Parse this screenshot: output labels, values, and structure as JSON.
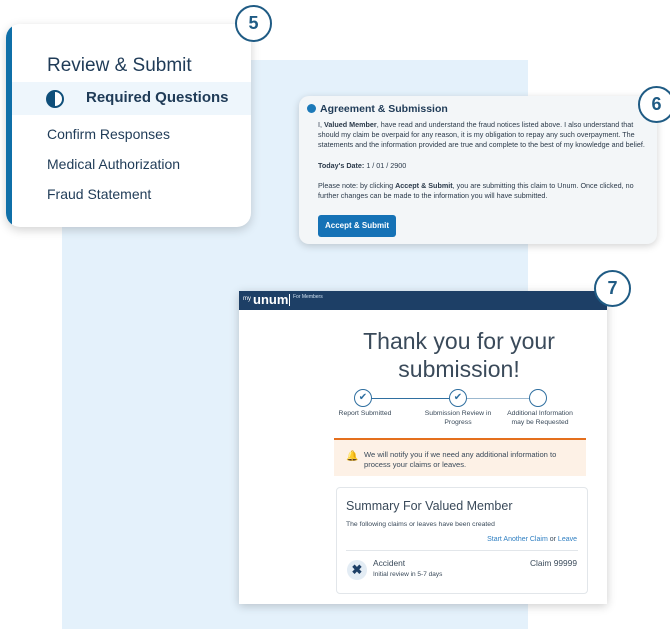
{
  "steps": {
    "five": "5",
    "six": "6",
    "seven": "7"
  },
  "review": {
    "title": "Review & Submit",
    "active_item": "Required Questions",
    "items": [
      "Confirm Responses",
      "Medical Authorization",
      "Fraud Statement"
    ]
  },
  "agreement": {
    "title": "Agreement & Submission",
    "para_prefix": "I, ",
    "member_name": "Valued Member",
    "para_rest": ", have read and understand the fraud notices listed above. I also understand that should my claim be overpaid for any reason, it is my obligation to repay any such overpayment. The statements and the information provided are true and complete to the best of my knowledge and belief.",
    "date_label": "Today's Date:",
    "date_value": "1 / 01 / 2900",
    "note_prefix": "Please note: by clicking ",
    "note_action": "Accept & Submit",
    "note_rest": ", you are submitting this claim to Unum. Once clicked, no further changes can be made to the information you will have submitted.",
    "button": "Accept & Submit"
  },
  "confirmation": {
    "logo_my": "my",
    "logo_brand": "unum",
    "logo_for": "For Members",
    "title": "Thank you for your submission!",
    "progress": [
      {
        "label": "Report Submitted",
        "status": "complete"
      },
      {
        "label": "Submission Review in Progress",
        "status": "complete"
      },
      {
        "label": "Additional Information may be Requested",
        "status": "pending"
      }
    ],
    "check_glyph": "✔",
    "notice_icon": "bell-icon",
    "notice": "We will notify you if we need any additional information to process your claims or leaves.",
    "summary_title": "Summary For Valued Member",
    "summary_sub": "The following claims or leaves have been created",
    "link_claim": "Start Another Claim",
    "link_or": "or",
    "link_leave": "Leave",
    "claim_icon": "accident-icon",
    "claim_name": "Accident",
    "claim_sub": "Initial review in 5-7 days",
    "claim_number": "Claim 99999"
  },
  "colors": {
    "primary": "#1572b6",
    "navy": "#1d3f66",
    "accent_orange": "#e46f1d",
    "panel_bg": "#e4f1fb"
  }
}
